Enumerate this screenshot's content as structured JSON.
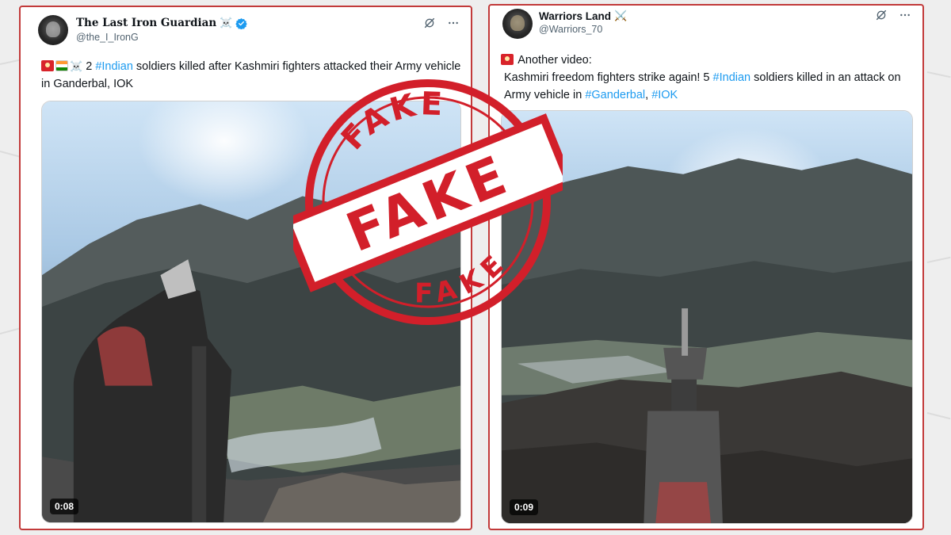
{
  "tweets": [
    {
      "display_name": "The Last Iron Guardian",
      "name_emoji": "☠️",
      "handle": "@the_I_IronG",
      "verified": true,
      "text_prefix_emoji": "🚨🇮🇳☠️",
      "text_parts": [
        {
          "text": " 2 ",
          "hashtag": false
        },
        {
          "text": "#Indian",
          "hashtag": true
        },
        {
          "text": " soldiers killed after Kashmiri fighters attacked their Army vehicle in Ganderbal, IOK",
          "hashtag": false
        }
      ],
      "video_duration": "0:08"
    },
    {
      "display_name": "Warriors Land",
      "name_emoji": "⚔️",
      "handle": "@Warriors_70",
      "verified": false,
      "line1_emoji": "🚨",
      "line1": "Another video:",
      "text_parts": [
        {
          "text": "Kashmiri freedom fighters strike again! 5 ",
          "hashtag": false
        },
        {
          "text": "#Indian",
          "hashtag": true
        },
        {
          "text": " soldiers killed in an attack on Army vehicle in ",
          "hashtag": false
        },
        {
          "text": "#Ganderbal",
          "hashtag": true
        },
        {
          "text": ", ",
          "hashtag": false
        },
        {
          "text": "#IOK",
          "hashtag": true
        }
      ],
      "video_duration": "0:09"
    }
  ],
  "stamp": {
    "top_word": "FAKE",
    "center_word": "FAKE",
    "bottom_word": "FAKE",
    "color": "#d21f2a"
  },
  "colors": {
    "card_border": "#c23a3a",
    "hashtag": "#1d9bf0",
    "verified": "#1d9bf0"
  },
  "icons": {
    "header_left": "grok-slash-icon",
    "header_right": "more-dots-icon"
  }
}
